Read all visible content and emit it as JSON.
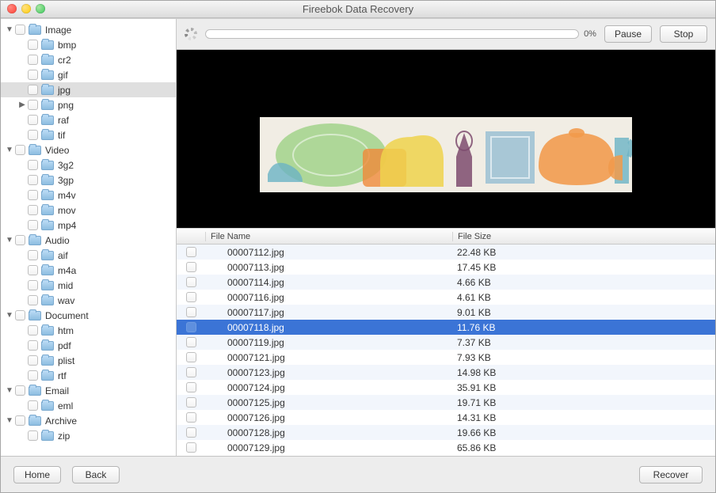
{
  "window": {
    "title": "Fireebok Data Recovery"
  },
  "progress": {
    "percent_label": "0%"
  },
  "buttons": {
    "pause": "Pause",
    "stop": "Stop",
    "home": "Home",
    "back": "Back",
    "recover": "Recover"
  },
  "table": {
    "headers": {
      "name": "File Name",
      "size": "File Size"
    }
  },
  "categories": [
    {
      "name": "Image",
      "expanded": true,
      "children": [
        {
          "name": "bmp"
        },
        {
          "name": "cr2"
        },
        {
          "name": "gif"
        },
        {
          "name": "jpg",
          "selected": true
        },
        {
          "name": "png",
          "has_children": true
        },
        {
          "name": "raf"
        },
        {
          "name": "tif"
        }
      ]
    },
    {
      "name": "Video",
      "expanded": true,
      "children": [
        {
          "name": "3g2"
        },
        {
          "name": "3gp"
        },
        {
          "name": "m4v"
        },
        {
          "name": "mov"
        },
        {
          "name": "mp4"
        }
      ]
    },
    {
      "name": "Audio",
      "expanded": true,
      "children": [
        {
          "name": "aif"
        },
        {
          "name": "m4a"
        },
        {
          "name": "mid"
        },
        {
          "name": "wav"
        }
      ]
    },
    {
      "name": "Document",
      "expanded": true,
      "children": [
        {
          "name": "htm"
        },
        {
          "name": "pdf"
        },
        {
          "name": "plist"
        },
        {
          "name": "rtf"
        }
      ]
    },
    {
      "name": "Email",
      "expanded": true,
      "children": [
        {
          "name": "eml"
        }
      ]
    },
    {
      "name": "Archive",
      "expanded": true,
      "children": [
        {
          "name": "zip"
        }
      ]
    }
  ],
  "files": [
    {
      "name": "00007112.jpg",
      "size": "22.48 KB"
    },
    {
      "name": "00007113.jpg",
      "size": "17.45 KB"
    },
    {
      "name": "00007114.jpg",
      "size": "4.66 KB"
    },
    {
      "name": "00007116.jpg",
      "size": "4.61 KB"
    },
    {
      "name": "00007117.jpg",
      "size": "9.01 KB"
    },
    {
      "name": "00007118.jpg",
      "size": "11.76 KB",
      "selected": true
    },
    {
      "name": "00007119.jpg",
      "size": "7.37 KB"
    },
    {
      "name": "00007121.jpg",
      "size": "7.93 KB"
    },
    {
      "name": "00007123.jpg",
      "size": "14.98 KB"
    },
    {
      "name": "00007124.jpg",
      "size": "35.91 KB"
    },
    {
      "name": "00007125.jpg",
      "size": "19.71 KB"
    },
    {
      "name": "00007126.jpg",
      "size": "14.31 KB"
    },
    {
      "name": "00007128.jpg",
      "size": "19.66 KB"
    },
    {
      "name": "00007129.jpg",
      "size": "65.86 KB"
    }
  ]
}
